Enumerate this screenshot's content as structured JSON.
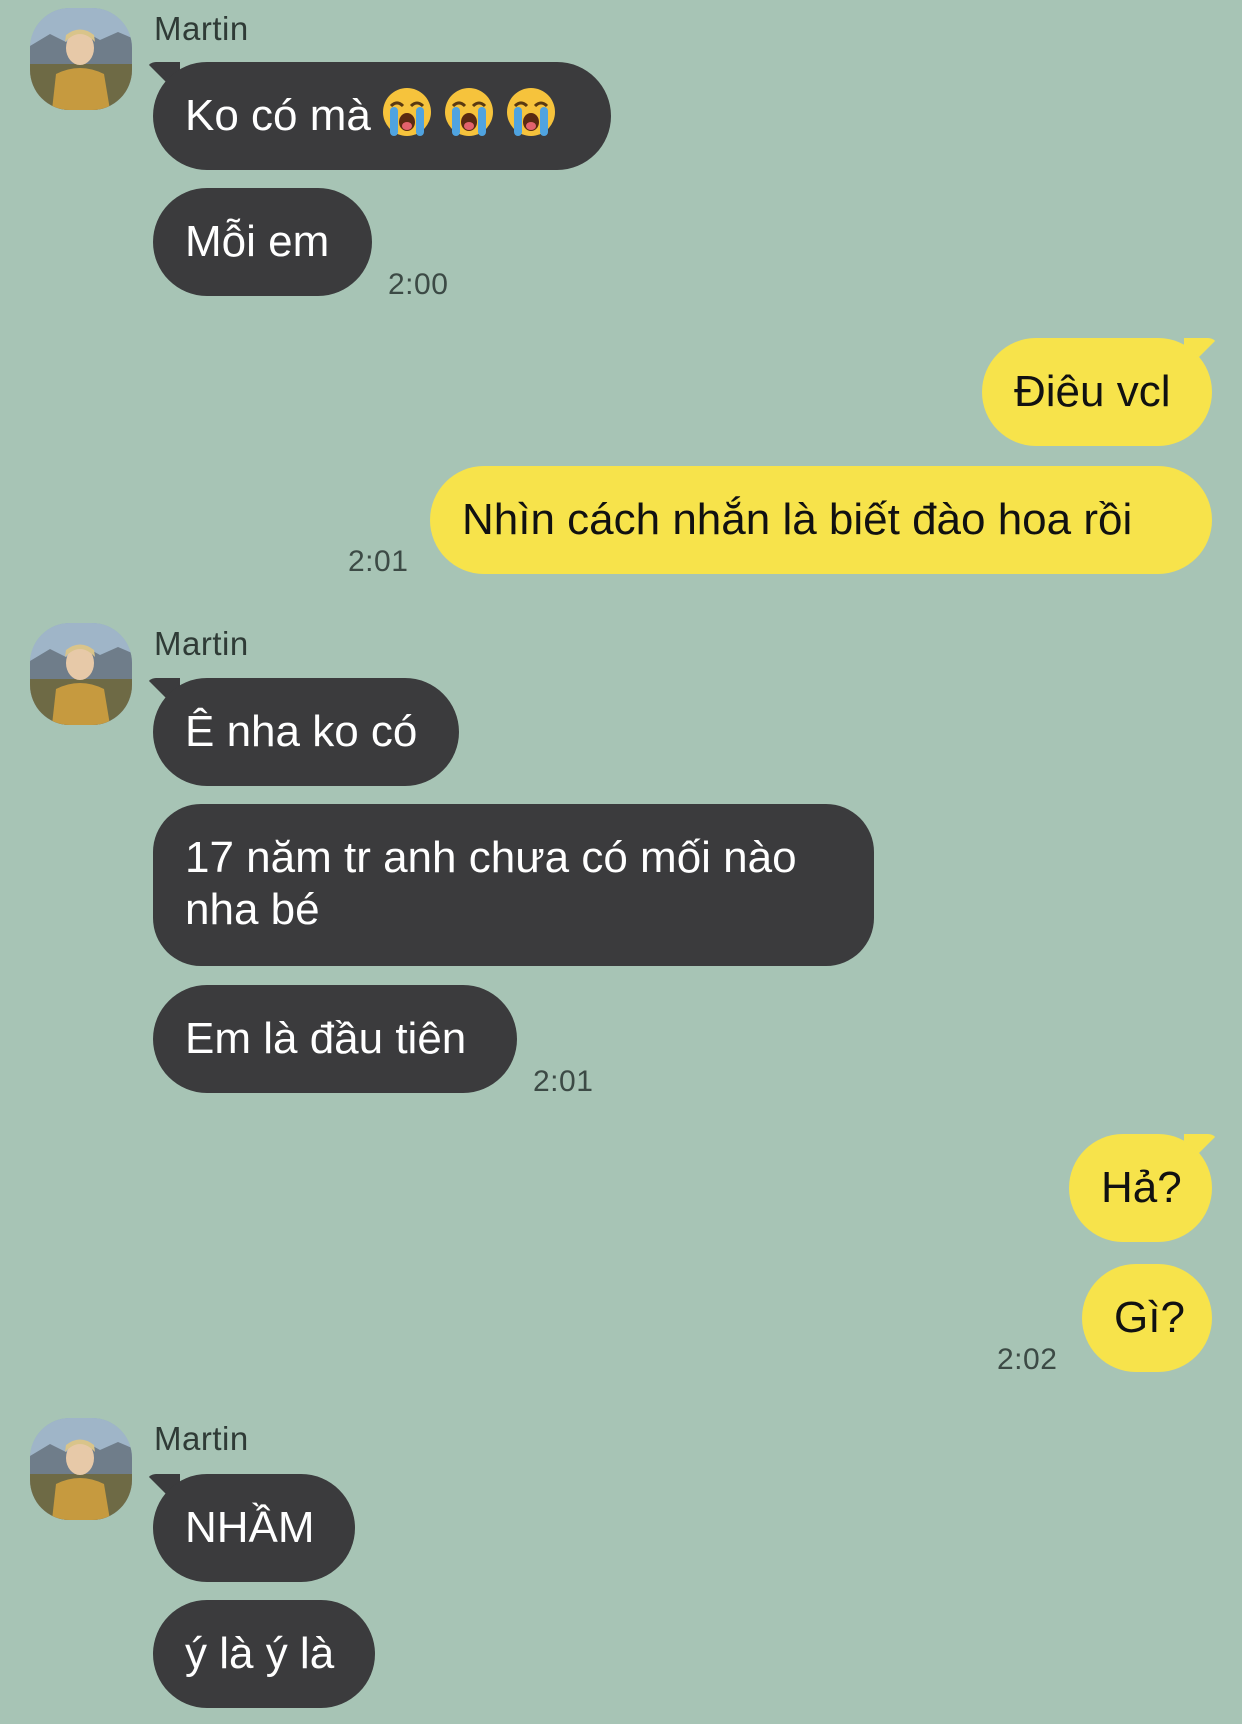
{
  "chat": {
    "groups": [
      {
        "sender": "Martin",
        "messages": [
          "Ko có mà",
          "Mỗi em"
        ],
        "emoji": "loudly-crying-face",
        "time": "2:00"
      },
      {
        "sender": "me",
        "messages": [
          "Điêu vcl",
          "Nhìn cách nhắn là biết đào hoa rồi"
        ],
        "time": "2:01"
      },
      {
        "sender": "Martin",
        "messages": [
          "Ê nha ko có",
          "17 năm tr anh chưa có mối nào nha bé",
          "Em là đầu tiên"
        ],
        "time": "2:01"
      },
      {
        "sender": "me",
        "messages": [
          "Hả?",
          "Gì?"
        ],
        "time": "2:02"
      },
      {
        "sender": "Martin",
        "messages": [
          "NHẦM",
          "ý là ý là"
        ]
      }
    ]
  },
  "colors": {
    "background": "#a7c4b5",
    "incoming_bubble": "#3b3b3d",
    "outgoing_bubble": "#f7e34b"
  }
}
